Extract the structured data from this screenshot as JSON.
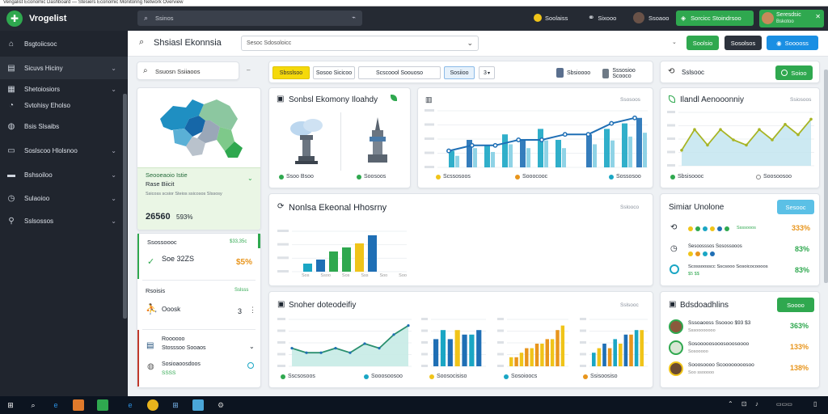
{
  "window": {
    "title": "Vengalist Economic Dashboard — Stesiers Economic Monitoring Network Overview"
  },
  "topbar": {
    "app_name": "Vrogelist",
    "search_placeholder": "Ssinos",
    "item1": "Soolaiss",
    "item2": "Sixooo",
    "item3": "Ssoaoo",
    "green_button": "Sorcicc Stoindrsoo",
    "user_name": "Seresdsic",
    "user_sub": "Bskotoo"
  },
  "sidebar": {
    "items": [
      {
        "icon": "home-icon",
        "label": "Bsgtoiicsoc"
      },
      {
        "icon": "grid-icon",
        "label": "Sicuvs Hiciny"
      },
      {
        "icon": "chart-icon",
        "label": "Shetoiosiors"
      },
      {
        "icon": "pie-icon",
        "label": "Svtohisy Eholso"
      },
      {
        "icon": "shield-icon",
        "label": "Bsis Slsaibs"
      },
      {
        "icon": "layers-icon",
        "label": "Soslscoo Hlolsnoo"
      },
      {
        "icon": "table-icon",
        "label": "Bshsoiloo"
      },
      {
        "icon": "clock-icon",
        "label": "Sulaoioo"
      },
      {
        "icon": "tag-icon",
        "label": "Sslsossos"
      }
    ]
  },
  "header": {
    "title": "Shsiasl Ekonnsia",
    "select_value": "Sesoc Sdosoloicc",
    "btn_green": "Soolsio",
    "btn_dark": "Sosolsos",
    "btn_blue": "Sooooss"
  },
  "search": {
    "placeholder": "Ssuosn Ssiiaoos"
  },
  "filters": {
    "chip1": "Sbsslsoo",
    "chip2": "Sosoo Sicicoo",
    "chip3": "Scscoool Soouoso",
    "chip4": "Sosiioo",
    "chip5": "3",
    "user1": "Sbsioooo",
    "user2": "Sssosioo Scooco"
  },
  "right_head": {
    "label": "Sslsooc",
    "button": "Soioo"
  },
  "map_card": {
    "heading": "Seooeaoio Istie",
    "subheading": "Rase Biicit",
    "desc": "Ssicoss scsior Steios ssicosos Slssosy",
    "value": "26560",
    "percent": "593%"
  },
  "left_list": [
    {
      "title": "Ssossoooc",
      "badge": "$33,35c",
      "value": "Soe 32ZS",
      "pct": "$5%"
    },
    {
      "title": "Rsoisis",
      "badge": "Sslsss",
      "value": "Ooosk",
      "count": "3"
    },
    {
      "title": "Roooooo",
      "line2": "Stosssoo Sooaos",
      "line3": "Sosioaoosdoos",
      "line4": "SSSS"
    }
  ],
  "card_landmarks": {
    "title": "Sonbsl Ekomony Iloahdy",
    "legend1": "Ssoo Bsoo",
    "legend2": "Soosoos"
  },
  "card_combo": {
    "legend1": "Scssosoos",
    "legend2": "Sooocooc",
    "legend3": "Sossosoo",
    "sub": "Ssosoos"
  },
  "card_area": {
    "title": "Ilandl Aenooonniy",
    "sub": "Ssiosoos",
    "legend1": "Sbsisoooc",
    "legend2": "Soosoosoo"
  },
  "card_bars": {
    "title": "Nonlsa Ekeonal Hhosrny",
    "sub": "Sslooco",
    "ticks": [
      "Sos",
      "Ssoo",
      "Sos",
      "Sss",
      "Soo",
      "Soo"
    ]
  },
  "card_activity": {
    "title": "Snoher doteodeifiy",
    "sub": "Sslsooc",
    "legend1": "Sscsosoos",
    "legend2": "Sooosoosoo",
    "legend3": "Soosocisiso",
    "legend4": "Sosoioocs",
    "legend5": "Ssisoosiso"
  },
  "card_similar": {
    "title": "Simiar Unolone",
    "button": "Sesooc",
    "rows": [
      {
        "label": "Ssssooos",
        "pct": "333%"
      },
      {
        "label": "Sesoosssos Sosossooos",
        "pct": "83%"
      },
      {
        "label": "Scossoosscc Sscsooo Sosoicocoooos",
        "pct": "83%"
      }
    ]
  },
  "card_people": {
    "title": "Bdsdoadhlins",
    "button": "Soooo",
    "rows": [
      {
        "name": "Sssoaooss Ssoooo $93 $3",
        "sub": "Sssoooooooo",
        "pct": "363%"
      },
      {
        "name": "Sosooooosooosooosoooo",
        "sub": "Sosooooo",
        "pct": "133%"
      },
      {
        "name": "Sooosoooo Scoooooooosoo",
        "sub": "Soo ssooooo",
        "pct": "138%"
      }
    ]
  },
  "colors": {
    "green": "#2fa84f",
    "teal": "#1aa6c4",
    "blue": "#1f6fb5",
    "yellow": "#f0c419",
    "orange": "#e8951c",
    "dark": "#252a33"
  },
  "chart_data": [
    {
      "type": "line",
      "series": [
        {
          "values": [
            3,
            4,
            4,
            5,
            5,
            6,
            6,
            8,
            9
          ]
        }
      ]
    },
    {
      "type": "bar",
      "values": [
        2,
        3,
        5,
        6,
        7,
        9
      ]
    },
    {
      "type": "area",
      "values": [
        3,
        7,
        4,
        7,
        5,
        4,
        7,
        5,
        8,
        6,
        9
      ]
    }
  ]
}
